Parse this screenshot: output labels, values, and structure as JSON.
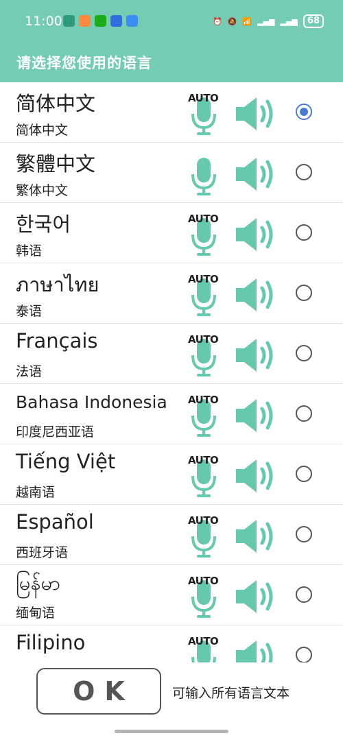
{
  "status_bar": {
    "time": "11:00",
    "battery": "68",
    "apps": [
      "#2e9a7a",
      "#ff8a3d",
      "#1aad19",
      "#2f6de0",
      "#3a8ef0"
    ]
  },
  "header": {
    "title": "请选择您使用的语言"
  },
  "colors": {
    "accent": "#74ccb3",
    "icon": "#66c9ad",
    "radio_selected": "#4a7bd8"
  },
  "languages": [
    {
      "native": "简体中文",
      "chinese": "简体中文",
      "auto": "AUTO",
      "selected": true
    },
    {
      "native": "繁體中文",
      "chinese": "繁体中文",
      "auto": "",
      "selected": false
    },
    {
      "native": "한국어",
      "chinese": "韩语",
      "auto": "AUTO",
      "selected": false
    },
    {
      "native": "ภาษาไทย",
      "chinese": "泰语",
      "auto": "AUTO",
      "selected": false
    },
    {
      "native": "Français",
      "chinese": "法语",
      "auto": "AUTO",
      "selected": false
    },
    {
      "native": "Bahasa Indonesia",
      "chinese": "印度尼西亚语",
      "auto": "AUTO",
      "selected": false
    },
    {
      "native": "Tiếng Việt",
      "chinese": "越南语",
      "auto": "AUTO",
      "selected": false
    },
    {
      "native": "Español",
      "chinese": "西班牙语",
      "auto": "AUTO",
      "selected": false
    },
    {
      "native": "မြန်မာ",
      "chinese": "缅甸语",
      "auto": "AUTO",
      "selected": false
    },
    {
      "native": "Filipino",
      "chinese": "",
      "auto": "AUTO",
      "selected": false
    }
  ],
  "footer": {
    "ok_label": "OK",
    "hint": "可输入所有语言文本"
  },
  "icons": {
    "mic": "microphone-icon",
    "speaker": "speaker-icon"
  }
}
